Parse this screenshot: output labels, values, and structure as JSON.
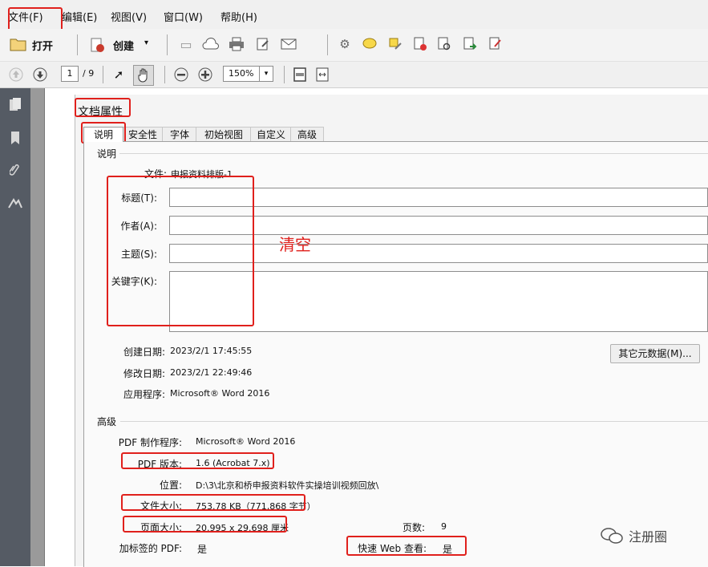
{
  "menu": {
    "file": "文件(F)",
    "edit": "编辑(E)",
    "view": "视图(V)",
    "window": "窗口(W)",
    "help": "帮助(H)"
  },
  "toolbar": {
    "open_label": "打开",
    "create_label": "创建",
    "page_current": "1",
    "page_total": "/ 9",
    "zoom_value": "150%"
  },
  "dialog": {
    "title": "文档属性",
    "tabs": [
      "说明",
      "安全性",
      "字体",
      "初始视图",
      "自定义",
      "高级"
    ],
    "description_group": "说明",
    "file_label": "文件:",
    "file_value": "申报资料排版-1",
    "title_label": "标题(T):",
    "author_label": "作者(A):",
    "subject_label": "主题(S):",
    "keywords_label": "关键字(K):",
    "title_value": "",
    "author_value": "",
    "subject_value": "",
    "keywords_value": "",
    "created_label": "创建日期:",
    "created_value": "2023/2/1 17:45:55",
    "modified_label": "修改日期:",
    "modified_value": "2023/2/1 22:49:46",
    "app_label": "应用程序:",
    "app_value": "Microsoft® Word 2016",
    "more_metadata_button": "其它元数据(M)...",
    "advanced_group": "高级",
    "producer_label": "PDF 制作程序:",
    "producer_value": "Microsoft® Word 2016",
    "pdf_version_label": "PDF 版本:",
    "pdf_version_value": "1.6 (Acrobat 7.x)",
    "location_label": "位置:",
    "location_value": "D:\\3\\北京和桥申报资料软件实操培训视频回放\\",
    "file_size_label": "文件大小:",
    "file_size_value": "753.78 KB（771,868 字节）",
    "page_size_label": "页面大小:",
    "page_size_value": "20.995 x 29.698 厘米",
    "page_count_label": "页数:",
    "page_count_value": "9",
    "tagged_label": "加标签的 PDF:",
    "tagged_value": "是",
    "fast_web_label": "快速 Web 查看:",
    "fast_web_value": "是"
  },
  "annotation": {
    "clear_text": "清空",
    "color": "#e0201c"
  },
  "watermark": {
    "text": "注册圈"
  }
}
